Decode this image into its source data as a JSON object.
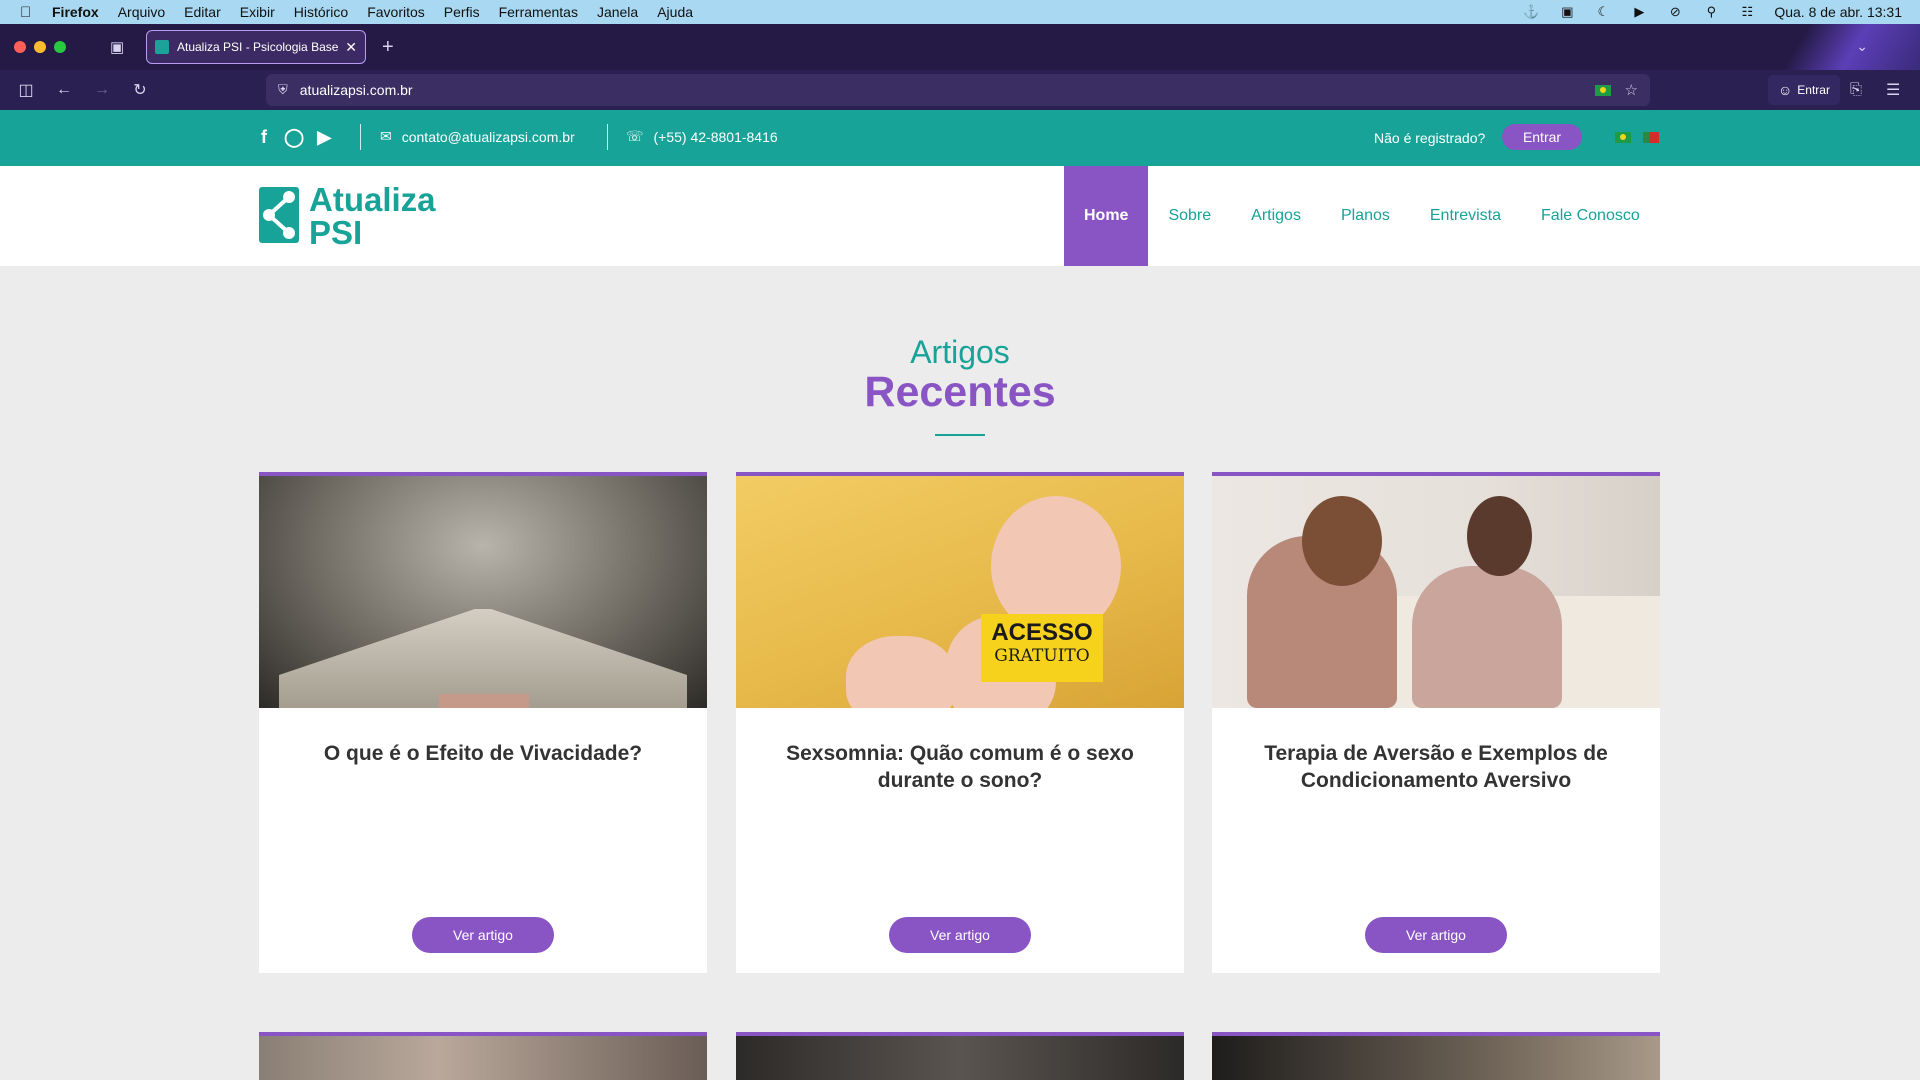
{
  "menubar": {
    "apple_icon": "apple-icon",
    "app": "Firefox",
    "items": [
      "Arquivo",
      "Editar",
      "Exibir",
      "Histórico",
      "Favoritos",
      "Perfis",
      "Ferramentas",
      "Janela",
      "Ajuda"
    ],
    "clock": "Qua. 8 de abr.  13:31"
  },
  "browser": {
    "tab_title": "Atualiza PSI - Psicologia Baseada",
    "url": "atualizapsi.com.br",
    "account_label": "Entrar"
  },
  "site": {
    "colors": {
      "primary": "#17a398",
      "accent": "#8954c4"
    },
    "topbar": {
      "email": "contato@atualizapsi.com.br",
      "phone": "(+55) 42-8801-8416",
      "not_registered": "Não é registrado?",
      "login_button": "Entrar"
    },
    "logo": {
      "line1": "Atualiza",
      "line2": "PSI"
    },
    "nav": [
      "Home",
      "Sobre",
      "Artigos",
      "Planos",
      "Entrevista",
      "Fale Conosco"
    ],
    "section": {
      "title_light": "Artigos",
      "title_bold": "Recentes"
    },
    "articles": [
      {
        "title": "O que é o Efeito de Vivacidade?",
        "button": "Ver artigo"
      },
      {
        "title": "Sexsomnia: Quão comum é o sexo durante o sono?",
        "button": "Ver artigo",
        "badge_line1": "ACESSO",
        "badge_line2": "GRATUITO"
      },
      {
        "title": "Terapia de Aversão e Exemplos de Condicionamento Aversivo",
        "button": "Ver artigo"
      }
    ]
  }
}
